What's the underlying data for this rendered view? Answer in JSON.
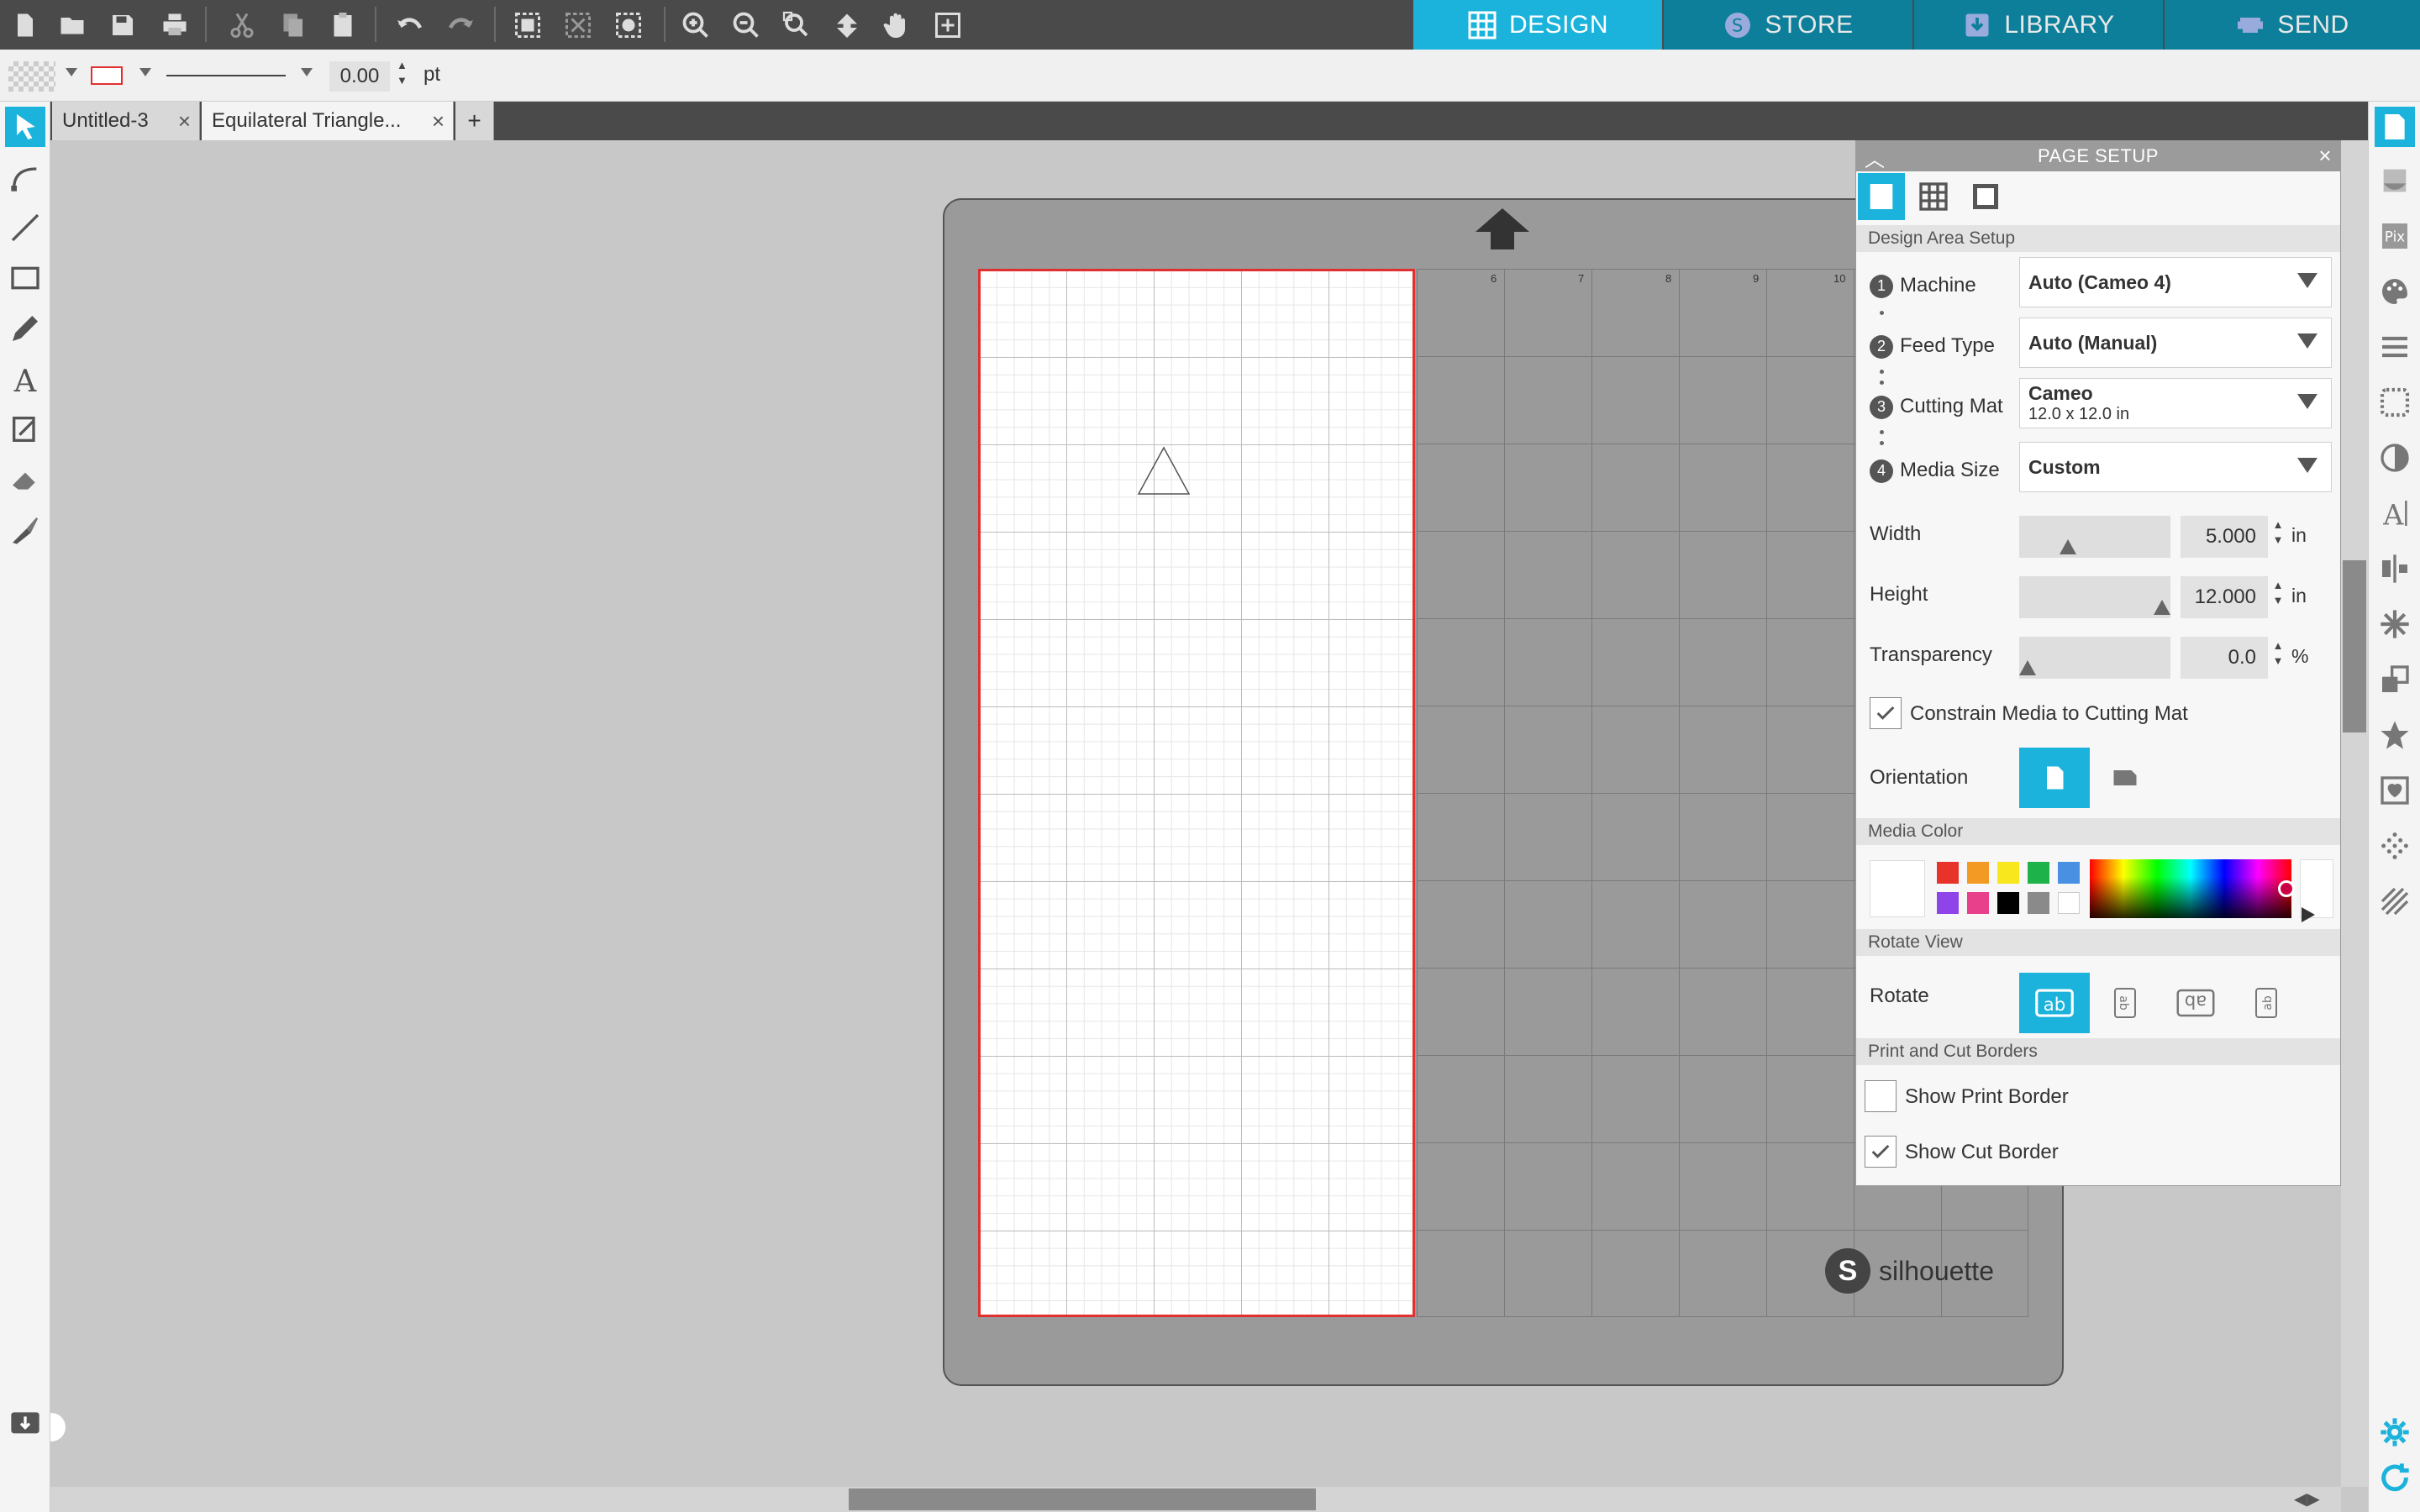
{
  "mode_tabs": [
    {
      "label": "DESIGN",
      "icon": "grid-icon"
    },
    {
      "label": "STORE",
      "icon": "silhouette-s-icon"
    },
    {
      "label": "LIBRARY",
      "icon": "download-box-icon"
    },
    {
      "label": "SEND",
      "icon": "cutter-icon"
    }
  ],
  "propbar": {
    "line_width": "0.00",
    "line_unit": "pt"
  },
  "doc_tabs": [
    {
      "label": "Untitled-3",
      "active": false
    },
    {
      "label": "Equilateral Triangle...",
      "active": true
    }
  ],
  "add_tab_symbol": "+",
  "ruler": [
    "6",
    "7",
    "8",
    "9",
    "10"
  ],
  "brand": {
    "logo_letter": "S",
    "name": "silhouette"
  },
  "panel": {
    "title": "PAGE SETUP",
    "sections": {
      "design_area": "Design Area Setup",
      "media_color": "Media Color",
      "rotate_view": "Rotate View",
      "borders": "Print and Cut Borders"
    },
    "machine": {
      "step": "1",
      "label": "Machine",
      "value": "Auto (Cameo 4)"
    },
    "feed": {
      "step": "2",
      "label": "Feed Type",
      "value": "Auto (Manual)"
    },
    "mat": {
      "step": "3",
      "label": "Cutting Mat",
      "value": "Cameo",
      "sub": "12.0 x 12.0 in"
    },
    "media_size": {
      "step": "4",
      "label": "Media Size",
      "value": "Custom"
    },
    "width": {
      "label": "Width",
      "value": "5.000",
      "unit": "in",
      "slider_fraction": 0.3
    },
    "height": {
      "label": "Height",
      "value": "12.000",
      "unit": "in",
      "slider_fraction": 1.0
    },
    "transparency": {
      "label": "Transparency",
      "value": "0.0",
      "unit": "%",
      "slider_fraction": 0.0
    },
    "constrain": {
      "label": "Constrain Media to Cutting Mat",
      "checked": true
    },
    "orientation_label": "Orientation",
    "rotate_label": "Rotate",
    "show_print_border": {
      "label": "Show Print Border",
      "checked": false
    },
    "show_cut_border": {
      "label": "Show Cut Border",
      "checked": true
    },
    "swatches": [
      "#e8332a",
      "#f39a24",
      "#f8e71c",
      "#1db34a",
      "#4a90e2",
      "#8e44e8",
      "#e8408a",
      "#000000",
      "#8a8a8a",
      "#ffffff"
    ]
  },
  "colors": {
    "accent": "#1bb3db",
    "toolbar": "#4a4a4a",
    "cut_line": "#e03030"
  }
}
